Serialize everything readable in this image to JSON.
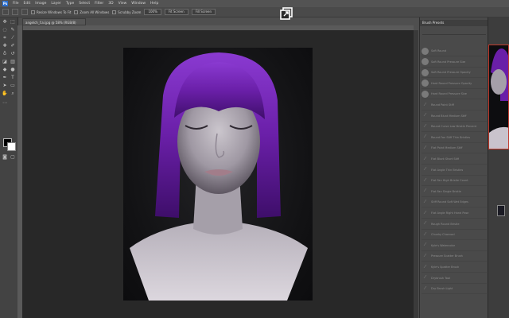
{
  "menu": {
    "logo": "Ps",
    "items": [
      "File",
      "Edit",
      "Image",
      "Layer",
      "Type",
      "Select",
      "Filter",
      "3D",
      "View",
      "Window",
      "Help"
    ]
  },
  "options": {
    "resize_windows": "Resize Windows To Fit",
    "zoom_all": "Zoom All Windows",
    "scrubby_zoom": "Scrubby Zoom",
    "zoom_pct": "100%",
    "fit_screen": "Fit Screen",
    "fill_screen": "Fill Screen"
  },
  "document": {
    "tab_title": "angelch_f.ai.jpg @ 58% (RGB/8)"
  },
  "panel": {
    "title": "Brush Presets",
    "brushes": [
      "Soft Round",
      "Soft Round Pressure Size",
      "Soft Round Pressure Opacity",
      "Hard Round Pressure Opacity",
      "Hard Round Pressure Size",
      "Round Point Stiff",
      "Round Blunt Medium Stiff",
      "Round Curve Low Bristle Percent",
      "Round Fan Stiff Thin Bristles",
      "Flat Point Medium Stiff",
      "Flat Blunt Short Stiff",
      "Flat Angle Thin Bristles",
      "Flat Fan High Bristle Count",
      "Flat Fan Single Bristle",
      "Stiff Round Soft Wet Edges",
      "Flat Angle Right Hand Pose",
      "Rough Round Bristle",
      "Chunky Charcoal",
      "Kyle's Watercolor",
      "Pressure Scatter Brush",
      "Kyle's Spatter Brush",
      "Drybrush Tool",
      "Dry Brush Light"
    ]
  },
  "colors": {
    "accent_purple": "#6a1fa8",
    "panel_bg": "#4a4a4a",
    "canvas_bg": "#282828",
    "nav_frame": "#c0392b"
  },
  "icons": {
    "center_overlay": "external-window-icon",
    "foreground": "foreground-color-swatch",
    "background": "background-color-swatch"
  }
}
